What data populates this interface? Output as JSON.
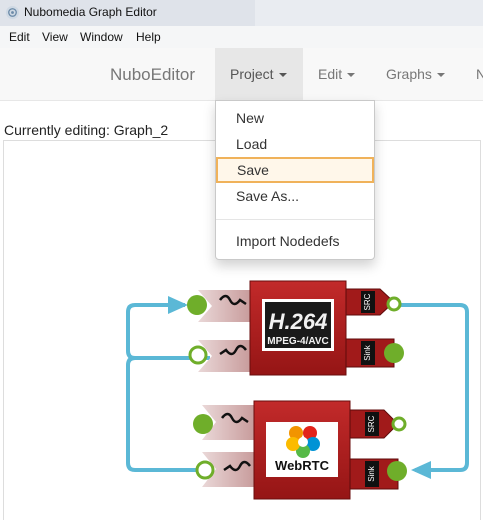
{
  "window": {
    "title": "Nubomedia Graph Editor"
  },
  "menubar": {
    "items": [
      "Edit",
      "View",
      "Window",
      "Help"
    ]
  },
  "navbar": {
    "brand": "NuboEditor",
    "items": [
      {
        "label": "Project",
        "active": true
      },
      {
        "label": "Edit"
      },
      {
        "label": "Graphs"
      },
      {
        "label": "N"
      }
    ]
  },
  "editing_label": "Currently editing: Graph_2",
  "project_menu": {
    "items": [
      "New",
      "Load",
      "Save",
      "Save As..."
    ],
    "focused": "Save",
    "footer_item": "Import Nodedefs"
  },
  "graph": {
    "nodes": [
      {
        "logo_main": "H.264",
        "logo_sub": "MPEG-4/AVC",
        "ports": [
          "SRC",
          "Sink"
        ]
      },
      {
        "logo_main": "WebRTC",
        "ports": [
          "SRC",
          "Sink"
        ]
      }
    ],
    "colors": {
      "node_red": "#b01c1c",
      "edge_blue": "#5bb8d6",
      "port_green": "#6fae2a"
    }
  }
}
